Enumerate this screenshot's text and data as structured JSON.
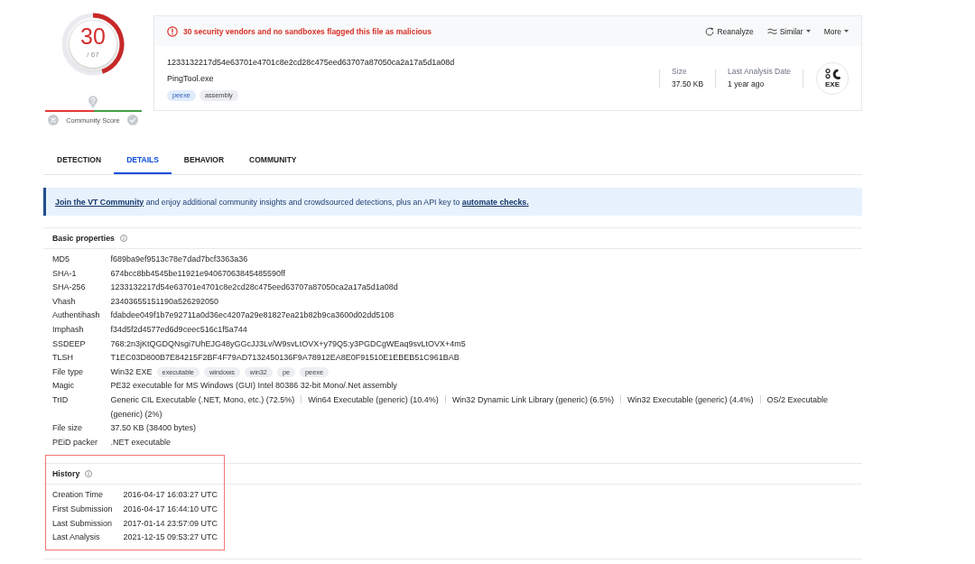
{
  "score": {
    "detections": "30",
    "total": "/ 67",
    "level": 0.448
  },
  "community_score": {
    "label": "Community Score",
    "level": 0.5
  },
  "file_card": {
    "alert": "30 security vendors and no sandboxes flagged this file as malicious",
    "actions": [
      {
        "label": "Reanalyze",
        "kind": "refresh"
      },
      {
        "label": "Similar",
        "kind": "similar"
      },
      {
        "label": "More",
        "kind": "menu"
      }
    ],
    "hash": "1233132217d54e63701e4701c8e2cd28c475eed63707a87050ca2a17a5d1a08d",
    "file_name": "PingTool.exe",
    "tags": [
      {
        "label": "peexe",
        "kind": "filetype"
      },
      {
        "label": "assembly",
        "kind": "plain"
      }
    ],
    "stats": [
      {
        "label": "Size",
        "value": "37.50 KB"
      },
      {
        "label": "Last Analysis Date",
        "value": "1 year ago"
      }
    ],
    "file_type_badge": "EXE"
  },
  "tabs": [
    {
      "label": "DETECTION",
      "selected": false
    },
    {
      "label": "DETAILS",
      "selected": true
    },
    {
      "label": "BEHAVIOR",
      "selected": false
    },
    {
      "label": "COMMUNITY",
      "selected": false
    }
  ],
  "banner": {
    "parts": [
      {
        "kind": "link",
        "text": "Join the VT Community"
      },
      {
        "kind": "text",
        "text": "and enjoy additional community insights and crowdsourced detections, plus an API key to"
      },
      {
        "kind": "link",
        "text": "automate checks."
      }
    ]
  },
  "basic_properties": {
    "title": "Basic properties",
    "rows": [
      {
        "label": "MD5",
        "kind": "text",
        "value": "f689ba9ef9513c78e7dad7bcf3363a36"
      },
      {
        "label": "SHA-1",
        "kind": "text",
        "value": "674bcc8bb4545be11921e94067063845485590ff"
      },
      {
        "label": "SHA-256",
        "kind": "text",
        "value": "1233132217d54e63701e4701c8e2cd28c475eed63707a87050ca2a17a5d1a08d"
      },
      {
        "label": "Vhash",
        "kind": "text",
        "value": "23403655151190a526292050"
      },
      {
        "label": "Authentihash",
        "kind": "text",
        "value": "fdabdee049f1b7e92711a0d36ec4207a29e81827ea21b82b9ca3600d02dd5108"
      },
      {
        "label": "Imphash",
        "kind": "text",
        "value": "f34d5f2d4577ed6d9ceec516c1f5a744"
      },
      {
        "label": "SSDEEP",
        "kind": "text",
        "value": "768:2n3jKtQGDQNsgi7UhEJG48yGGcJJ3Lv/W9svLtOVX+y79Q5:y3PGDCgWEaq9svLtOVX+4m5"
      },
      {
        "label": "TLSH",
        "kind": "text",
        "value": "T1EC03D800B7E84215F2BF4F79AD7132450136F9A78912EA8E0F91510E1EBEB51C961BAB"
      },
      {
        "label": "File type",
        "kind": "tags",
        "value": "Win32 EXE",
        "tags": [
          "executable",
          "windows",
          "win32",
          "pe",
          "peexe"
        ]
      },
      {
        "label": "Magic",
        "kind": "text",
        "value": "PE32 executable for MS Windows (GUI) Intel 80386 32-bit Mono/.Net assembly"
      },
      {
        "label": "TrID",
        "kind": "list",
        "entries": [
          "Generic CIL Executable (.NET, Mono, etc.) (72.5%)",
          "Win64 Executable (generic) (10.4%)",
          "Win32 Dynamic Link Library (generic) (6.5%)",
          "Win32 Executable (generic) (4.4%)",
          "OS/2 Executable (generic) (2%)"
        ]
      },
      {
        "label": "File size",
        "kind": "text",
        "value": "37.50 KB (38400 bytes)"
      },
      {
        "label": "PEiD packer",
        "kind": "text",
        "value": ".NET executable"
      }
    ]
  },
  "history": {
    "title": "History",
    "highlighted": true,
    "rows": [
      {
        "label": "Creation Time",
        "kind": "text",
        "value": "2016-04-17 16:03:27 UTC"
      },
      {
        "label": "First Submission",
        "kind": "text",
        "value": "2016-04-17 16:44:10 UTC"
      },
      {
        "label": "Last Submission",
        "kind": "text",
        "value": "2017-01-14 23:57:09 UTC"
      },
      {
        "label": "Last Analysis",
        "kind": "text",
        "value": "2021-12-15 09:53:27 UTC"
      }
    ]
  }
}
